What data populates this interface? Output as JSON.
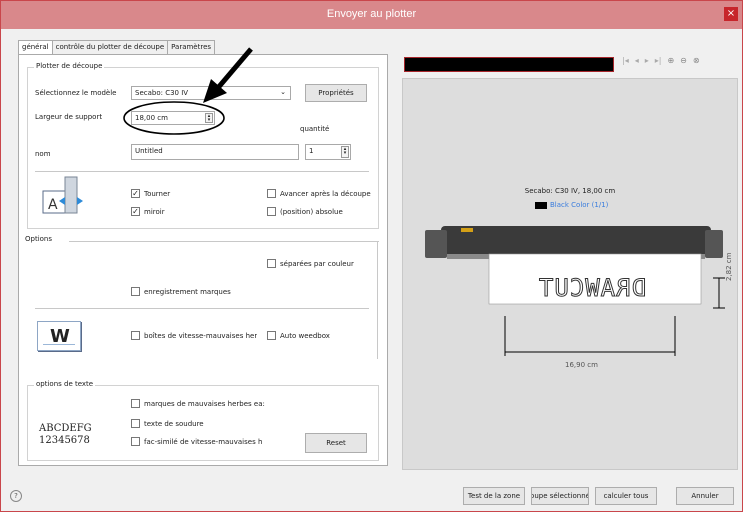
{
  "window": {
    "title": "Envoyer au plotter",
    "close_label": "×"
  },
  "tabs": [
    "général",
    "contrôle du plotter de découpe",
    "Paramètres"
  ],
  "plotter": {
    "legend": "Plotter de découpe",
    "model_label": "Sélectionnez le modèle",
    "model_value": "Secabo: C30 IV",
    "properties_button": "Propriétés",
    "width_label": "Largeur de support",
    "width_value": "18,00 cm",
    "quantity_label": "quantité",
    "name_label": "nom",
    "name_value": "Untitled",
    "quantity_value": "1",
    "rotate_label": "Tourner",
    "rotate_checked": true,
    "mirror_label": "miroir",
    "mirror_checked": true,
    "advance_label": "Avancer après la découpe",
    "advance_checked": false,
    "absolute_label": "(position) absolue",
    "absolute_checked": false
  },
  "options": {
    "legend": "Options",
    "separate_color_label": "séparées par couleur",
    "registration_marks_label": "enregistrement marques",
    "weed_boxes_label": "boîtes de vitesse-mauvaises her",
    "auto_weedbox_label": "Auto weedbox",
    "w_icon_text": "W"
  },
  "text_options": {
    "legend": "options de texte",
    "weed_marks_label": "marques de mauvaises herbes ea:",
    "weld_text_label": "texte de soudure",
    "facsimile_label": "fac-similé de vitesse-mauvaises h",
    "sample_line1": "ABCDEFG",
    "sample_line2": "12345678",
    "reset_button": "Reset"
  },
  "preview": {
    "device_caption": "Secabo: C30 IV,  18,00 cm",
    "layer_label": "Black Color (1/1)",
    "layer_color": "#000000",
    "layer_text_color": "#3b7ddd",
    "art_text": "DRAWCUT",
    "height_dim": "2,82 cm",
    "width_dim": "16,90 cm"
  },
  "footer": {
    "help_icon": "?",
    "test_zone_button": "Test de la zone",
    "cut_selection_button": "oupe sélectionné",
    "compute_all_button": "calculer tous",
    "cancel_button": "Annuler"
  }
}
